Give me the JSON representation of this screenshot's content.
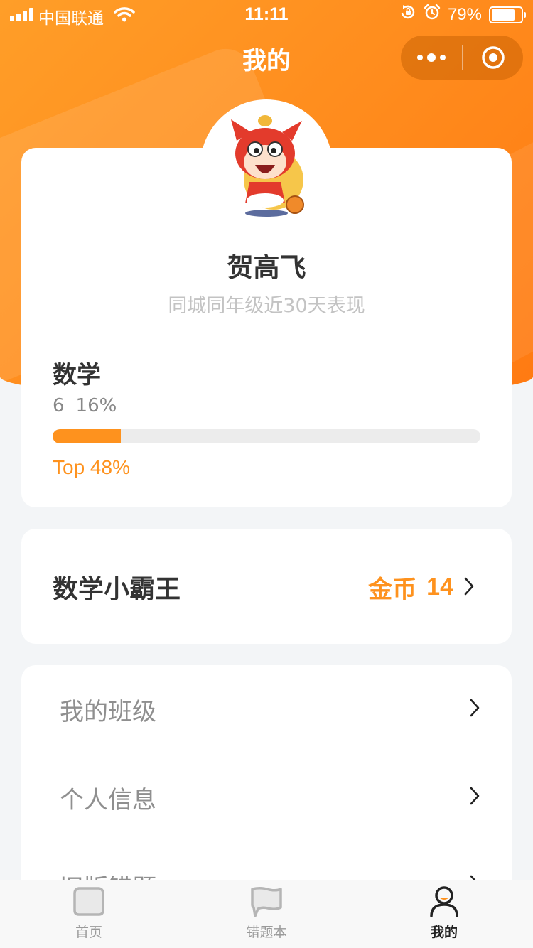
{
  "status_bar": {
    "carrier": "中国联通",
    "time": "11:11",
    "battery": "79%",
    "battery_level": 0.79,
    "icons": [
      "signal-icon",
      "wifi-icon",
      "rotation-lock-icon",
      "alarm-icon",
      "battery-icon"
    ]
  },
  "nav": {
    "title": "我的",
    "capsule_icons": [
      "more-dots-icon",
      "close-target-icon"
    ]
  },
  "profile": {
    "avatar": "cartoon-fox-avatar",
    "name": "贺高飞",
    "subtitle": "同城同年级近30天表现",
    "subject": "数学",
    "count": "6",
    "percent": "16%",
    "progress": 0.16,
    "rank": "Top 48%"
  },
  "coins_card": {
    "title": "数学小霸王",
    "label": "金币",
    "value": "14"
  },
  "menu": {
    "items": [
      {
        "label": "我的班级"
      },
      {
        "label": "个人信息"
      },
      {
        "label": "旧版错题"
      }
    ]
  },
  "tabbar": {
    "tabs": [
      {
        "label": "首页",
        "icon": "home-icon",
        "active": false
      },
      {
        "label": "错题本",
        "icon": "notebook-icon",
        "active": false
      },
      {
        "label": "我的",
        "icon": "profile-icon",
        "active": true
      }
    ]
  },
  "colors": {
    "accent": "#fe921e",
    "header": "#ff8a1c",
    "background": "#f3f5f7"
  }
}
